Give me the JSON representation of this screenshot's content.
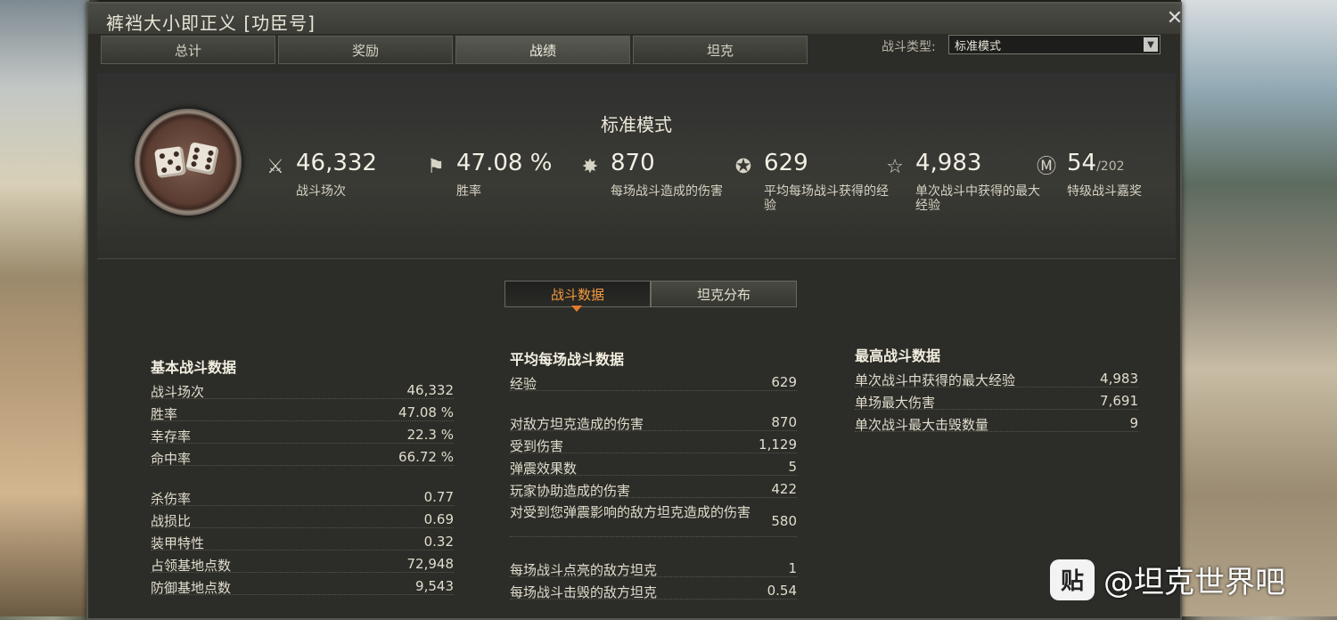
{
  "window": {
    "title": "裤裆大小即正义 [功臣号]"
  },
  "tabs": [
    {
      "label": "总计"
    },
    {
      "label": "奖励"
    },
    {
      "label": "战绩"
    },
    {
      "label": "坦克"
    }
  ],
  "filter": {
    "label": "战斗类型:",
    "selected": "标准模式"
  },
  "summary": {
    "mode_title": "标准模式",
    "stats": [
      {
        "icon": "crossed-swords-icon",
        "value": "46,332",
        "label": "战斗场次"
      },
      {
        "icon": "flag-icon",
        "value": "47.08 %",
        "label": "胜率"
      },
      {
        "icon": "tank-damage-icon",
        "value": "870",
        "label": "每场战斗造成的伤害"
      },
      {
        "icon": "star-wreath-icon",
        "value": "629",
        "label": "平均每场战斗获得的经验"
      },
      {
        "icon": "star-icon",
        "value": "4,983",
        "label": "单次战斗中获得的最大经验"
      },
      {
        "icon": "mastery-badge-icon",
        "value": "54",
        "value_suffix": "/202",
        "label": "特级战斗嘉奖"
      }
    ]
  },
  "subtabs": [
    {
      "label": "战斗数据"
    },
    {
      "label": "坦克分布"
    }
  ],
  "columns": {
    "basic": {
      "title": "基本战斗数据",
      "rows": [
        {
          "k": "战斗场次",
          "v": "46,332"
        },
        {
          "k": "胜率",
          "v": "47.08 %"
        },
        {
          "k": "幸存率",
          "v": "22.3 %"
        },
        {
          "k": "命中率",
          "v": "66.72 %"
        },
        {
          "k": "杀伤率",
          "v": "0.77"
        },
        {
          "k": "战损比",
          "v": "0.69"
        },
        {
          "k": "装甲特性",
          "v": "0.32"
        },
        {
          "k": "占领基地点数",
          "v": "72,948"
        },
        {
          "k": "防御基地点数",
          "v": "9,543"
        }
      ]
    },
    "average": {
      "title": "平均每场战斗数据",
      "rows": [
        {
          "k": "经验",
          "v": "629"
        },
        {
          "k": "对敌方坦克造成的伤害",
          "v": "870"
        },
        {
          "k": "受到伤害",
          "v": "1,129"
        },
        {
          "k": "弹震效果数",
          "v": "5"
        },
        {
          "k": "玩家协助造成的伤害",
          "v": "422"
        },
        {
          "k": "对受到您弹震影响的敌方坦克造成的伤害",
          "v": "580"
        },
        {
          "k": "每场战斗点亮的敌方坦克",
          "v": "1"
        },
        {
          "k": "每场战斗击毁的敌方坦克",
          "v": "0.54"
        }
      ]
    },
    "best": {
      "title": "最高战斗数据",
      "rows": [
        {
          "k": "单次战斗中获得的最大经验",
          "v": "4,983"
        },
        {
          "k": "单场最大伤害",
          "v": "7,691"
        },
        {
          "k": "单次战斗最大击毁数量",
          "v": "9"
        }
      ]
    }
  },
  "watermark": {
    "badge": "贴",
    "text": "@坦克世界吧"
  }
}
